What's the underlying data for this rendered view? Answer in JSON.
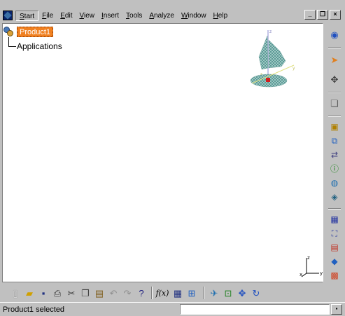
{
  "menu": {
    "items": [
      "Start",
      "File",
      "Edit",
      "View",
      "Insert",
      "Tools",
      "Analyze",
      "Window",
      "Help"
    ]
  },
  "window_controls": {
    "minimize": "_",
    "restore": "❐",
    "close": "×"
  },
  "tree": {
    "root_label": "Product1",
    "child_label": "Applications"
  },
  "axis": {
    "x": "x",
    "y": "y",
    "z": "z"
  },
  "status": {
    "text": "Product1 selected",
    "command_placeholder": ""
  },
  "colors": {
    "selection_highlight": "#f08020",
    "canvas": "#ffffff",
    "chrome": "#c0c0c0"
  }
}
